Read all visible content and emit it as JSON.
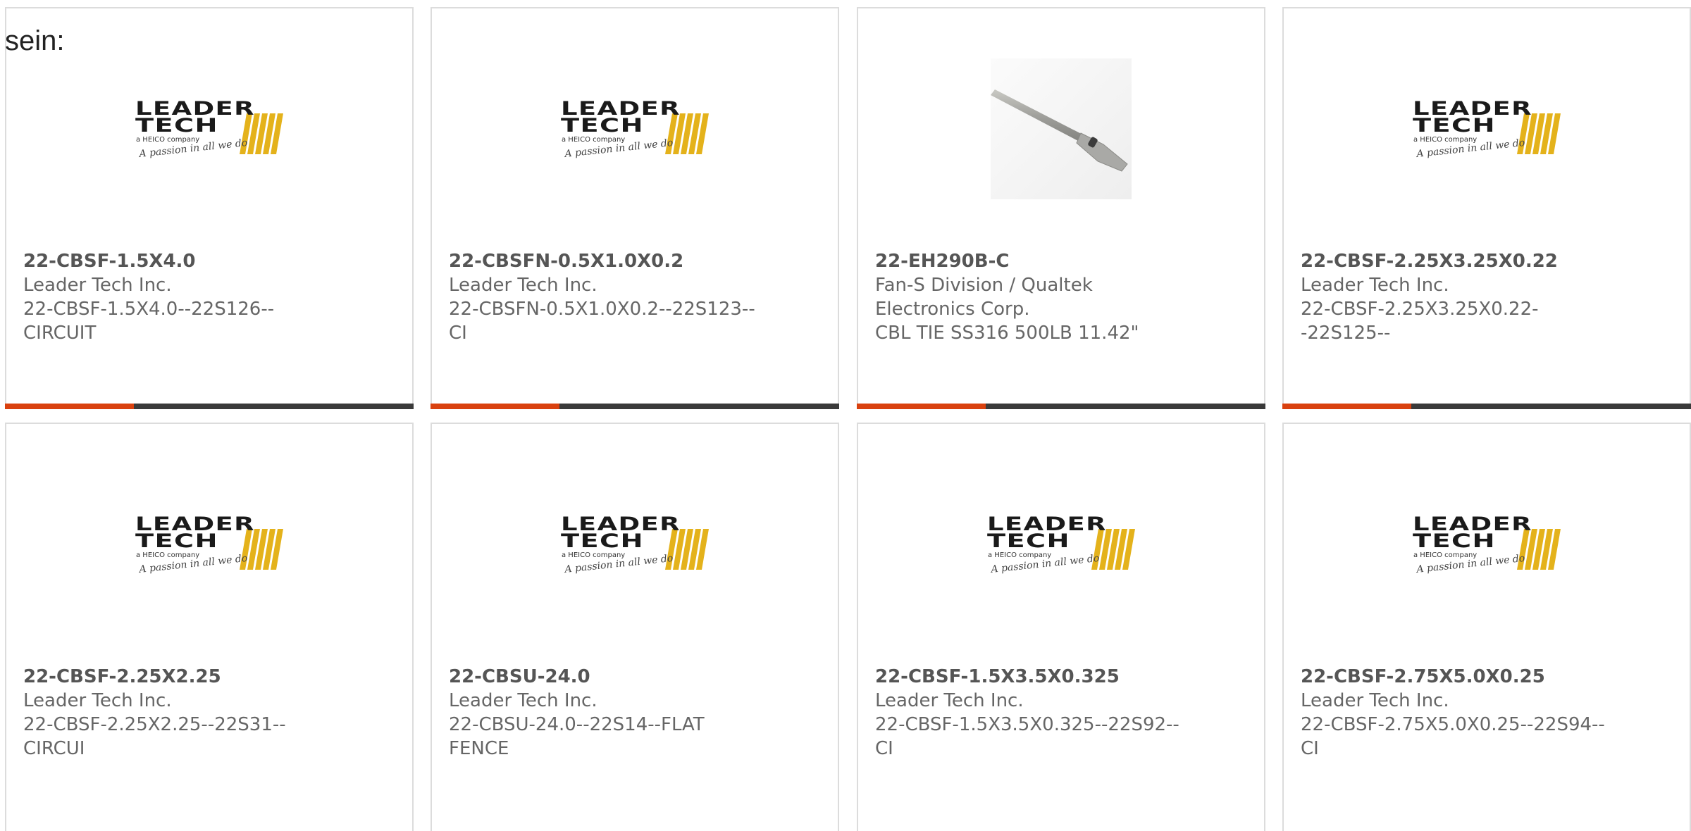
{
  "heading": "sein:",
  "accent_color": "#d9410f",
  "bar_color": "#3a3a3a",
  "logo": {
    "line1": "LEADER",
    "line2": "TECH",
    "line3": "a HEICO company",
    "tagline": "A passion in all we do"
  },
  "cards": [
    {
      "part": "22-CBSF-1.5X4.0",
      "maker": "Leader Tech Inc.",
      "desc": "22-CBSF-1.5X4.0--22S126--CIRCUIT",
      "image": "leader-tech-logo"
    },
    {
      "part": "22-CBSFN-0.5X1.0X0.2",
      "maker": "Leader Tech Inc.",
      "desc": "22-CBSFN-0.5X1.0X0.2--22S123--CI",
      "image": "leader-tech-logo"
    },
    {
      "part": "22-EH290B-C",
      "maker": "Fan-S Division / Qualtek Electronics Corp.",
      "desc": "CBL TIE SS316 500LB 11.42\"",
      "image": "cable-tie-photo"
    },
    {
      "part": "22-CBSF-2.25X3.25X0.22",
      "maker": "Leader Tech Inc.",
      "desc": "22-CBSF-2.25X3.25X0.22--22S125--",
      "image": "leader-tech-logo"
    },
    {
      "part": "22-CBSF-2.25X2.25",
      "maker": "Leader Tech Inc.",
      "desc": "22-CBSF-2.25X2.25--22S31--CIRCUI",
      "image": "leader-tech-logo"
    },
    {
      "part": "22-CBSU-24.0",
      "maker": "Leader Tech Inc.",
      "desc": "22-CBSU-24.0--22S14--FLAT FENCE",
      "image": "leader-tech-logo"
    },
    {
      "part": "22-CBSF-1.5X3.5X0.325",
      "maker": "Leader Tech Inc.",
      "desc": "22-CBSF-1.5X3.5X0.325--22S92--CI",
      "image": "leader-tech-logo"
    },
    {
      "part": "22-CBSF-2.75X5.0X0.25",
      "maker": "Leader Tech Inc.",
      "desc": "22-CBSF-2.75X5.0X0.25--22S94--CI",
      "image": "leader-tech-logo"
    }
  ]
}
